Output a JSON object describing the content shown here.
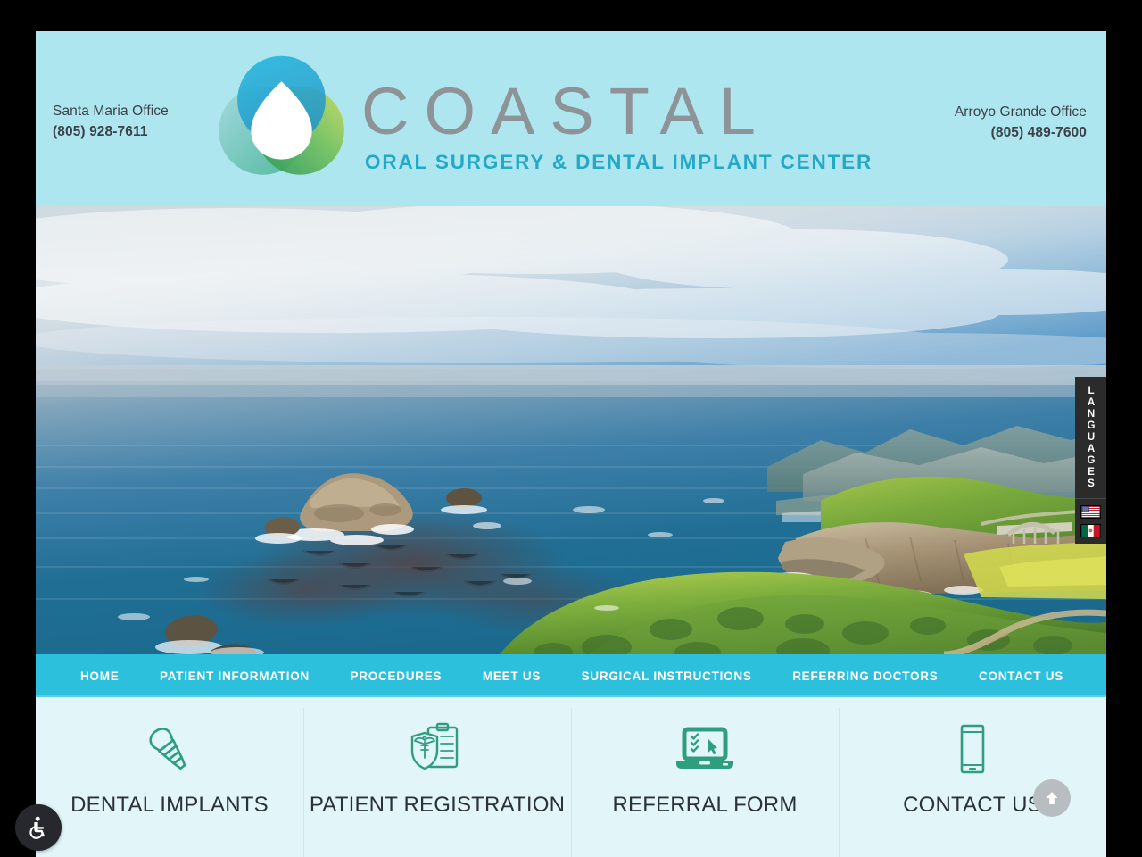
{
  "header": {
    "offices": [
      {
        "label": "Santa Maria Office",
        "phone": "(805) 928-7611"
      },
      {
        "label": "Arroyo Grande Office",
        "phone": "(805) 489-7600"
      }
    ],
    "logo": {
      "wordmark": "COASTAL",
      "tagline": "ORAL SURGERY & DENTAL IMPLANT CENTER",
      "mark_colors": [
        "#1fa7d4",
        "#2e9e58",
        "#a8c84a",
        "#9fd6d8"
      ],
      "wordmark_color": "#8d9396",
      "tagline_color": "#23a8c8",
      "background": "#aee6ef"
    }
  },
  "hero": {
    "alt": "Big Sur coastline with Bixby Bridge, ocean and green hills"
  },
  "nav": {
    "background": "#2cc0dd",
    "items": [
      {
        "label": "HOME",
        "name": "home"
      },
      {
        "label": "PATIENT INFORMATION",
        "name": "patient-information"
      },
      {
        "label": "PROCEDURES",
        "name": "procedures"
      },
      {
        "label": "MEET US",
        "name": "meet-us"
      },
      {
        "label": "SURGICAL INSTRUCTIONS",
        "name": "surgical-instructions"
      },
      {
        "label": "REFERRING DOCTORS",
        "name": "referring-doctors"
      },
      {
        "label": "CONTACT US",
        "name": "contact-us"
      }
    ]
  },
  "quicklinks": {
    "background": "#e2f6f9",
    "icon_color": "#2e9e7e",
    "items": [
      {
        "label": "DENTAL IMPLANTS",
        "icon": "dental-implant-icon"
      },
      {
        "label": "PATIENT REGISTRATION",
        "icon": "clipboard-shield-caduceus-icon"
      },
      {
        "label": "REFERRAL FORM",
        "icon": "laptop-checklist-icon"
      },
      {
        "label": "CONTACT US",
        "icon": "smartphone-icon"
      }
    ]
  },
  "languages": {
    "title": "LANGUAGES",
    "options": [
      {
        "name": "english",
        "flag": "us-flag-icon"
      },
      {
        "name": "spanish",
        "flag": "mexico-flag-icon"
      }
    ]
  },
  "widgets": {
    "accessibility_label": "Accessibility",
    "scroll_top_label": "Back to top"
  }
}
